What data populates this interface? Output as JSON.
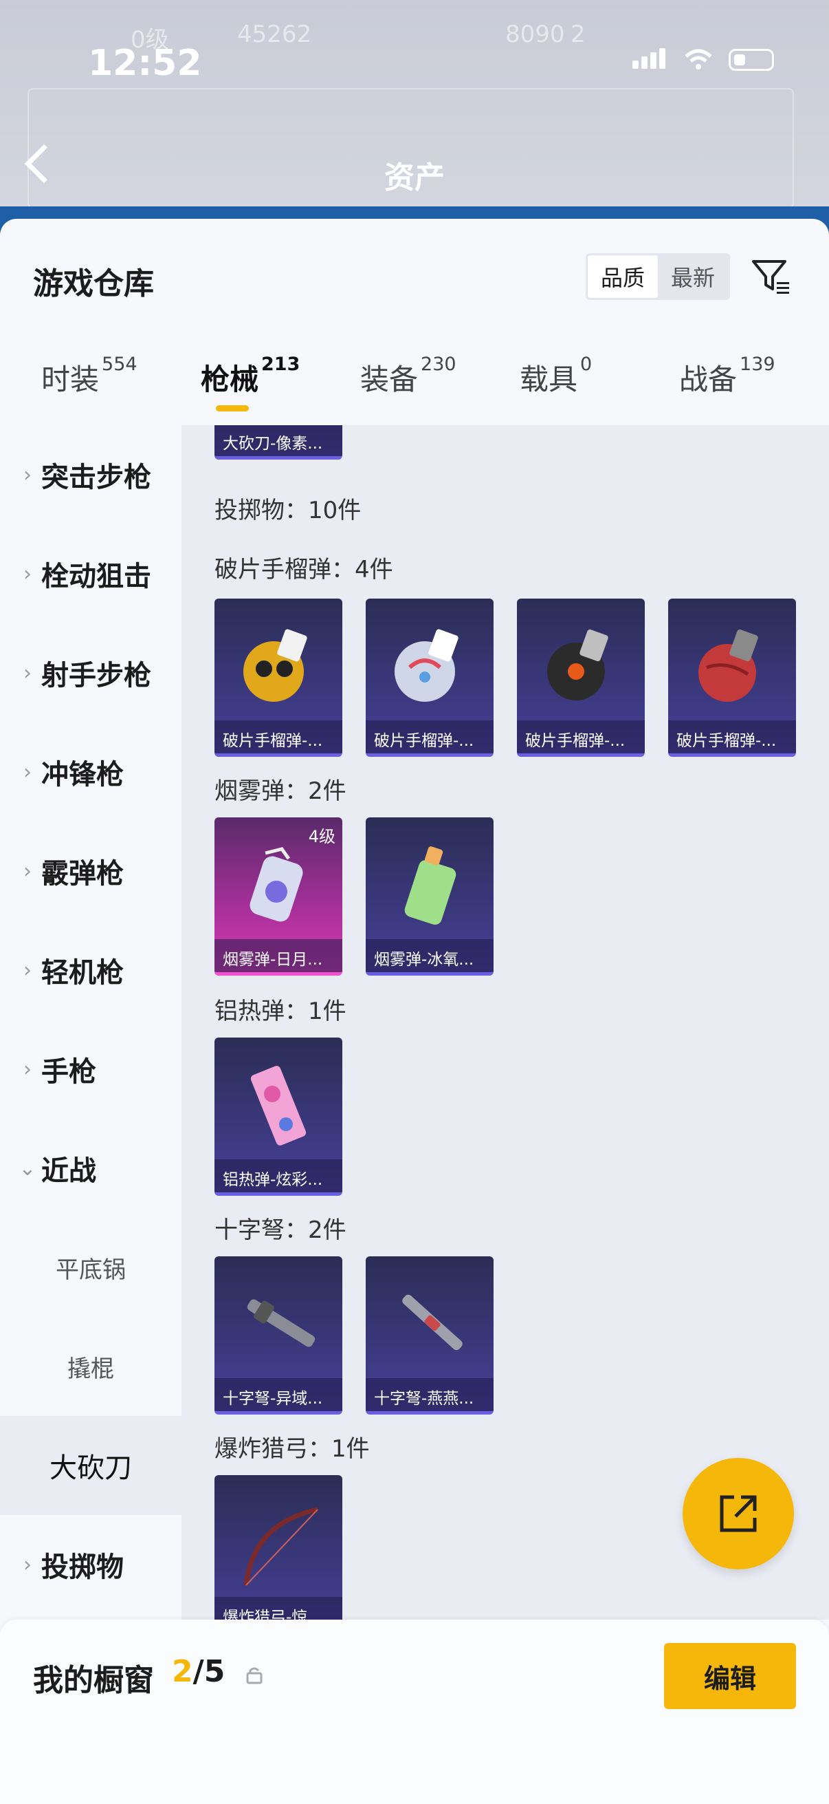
{
  "status_bar": {
    "time": "12:52"
  },
  "background_header": {
    "title": "资产",
    "ghost_1": "0级",
    "ghost_2": "45262",
    "ghost_3": "8090",
    "ghost_4": "2"
  },
  "sheet": {
    "title": "游戏仓库",
    "sort": {
      "options": [
        "品质",
        "最新"
      ],
      "active": "品质"
    }
  },
  "tabs": [
    {
      "label": "时装",
      "count": "554"
    },
    {
      "label": "枪械",
      "count": "213",
      "active": true
    },
    {
      "label": "装备",
      "count": "230"
    },
    {
      "label": "载具",
      "count": "0"
    },
    {
      "label": "战备",
      "count": "139"
    }
  ],
  "left_nav": {
    "items": [
      {
        "label": "突击步枪"
      },
      {
        "label": "栓动狙击"
      },
      {
        "label": "射手步枪"
      },
      {
        "label": "冲锋枪"
      },
      {
        "label": "霰弹枪"
      },
      {
        "label": "轻机枪"
      },
      {
        "label": "手枪"
      },
      {
        "label": "近战",
        "expanded": true
      }
    ],
    "sub_items": [
      {
        "label": "平底锅"
      },
      {
        "label": "撬棍"
      },
      {
        "label": "大砍刀",
        "selected": true
      }
    ],
    "last_item": {
      "label": "投掷物"
    }
  },
  "content": {
    "top_partial_caption": "大砍刀-像素...",
    "throwables_summary": "投掷物：10件",
    "sections": [
      {
        "label": "破片手榴弹：4件",
        "items": [
          {
            "caption": "破片手榴弹-...",
            "color": "#e0a81a"
          },
          {
            "caption": "破片手榴弹-...",
            "color": "#cfd6e8"
          },
          {
            "caption": "破片手榴弹-...",
            "color": "#2b2b2b"
          },
          {
            "caption": "破片手榴弹-...",
            "color": "#c43a3a"
          }
        ]
      },
      {
        "label": "烟雾弹：2件",
        "items": [
          {
            "caption": "烟雾弹-日月...",
            "level": "4级",
            "rarity": "pink"
          },
          {
            "caption": "烟雾弹-冰氧..."
          }
        ]
      },
      {
        "label": "铝热弹：1件",
        "items": [
          {
            "caption": "铝热弹-炫彩..."
          }
        ]
      },
      {
        "label": "十字弩：2件",
        "items": [
          {
            "caption": "十字弩-异域..."
          },
          {
            "caption": "十字弩-燕燕..."
          }
        ]
      },
      {
        "label": "爆炸猎弓：1件",
        "items": [
          {
            "caption": "爆炸猎弓-惊..."
          }
        ]
      }
    ]
  },
  "bottom_bar": {
    "label": "我的橱窗",
    "current": "2",
    "total": "/5",
    "edit_label": "编辑"
  },
  "colors": {
    "accent": "#f5b70a",
    "card_blue": "#3e3a84",
    "card_pink": "#d93bb4"
  }
}
